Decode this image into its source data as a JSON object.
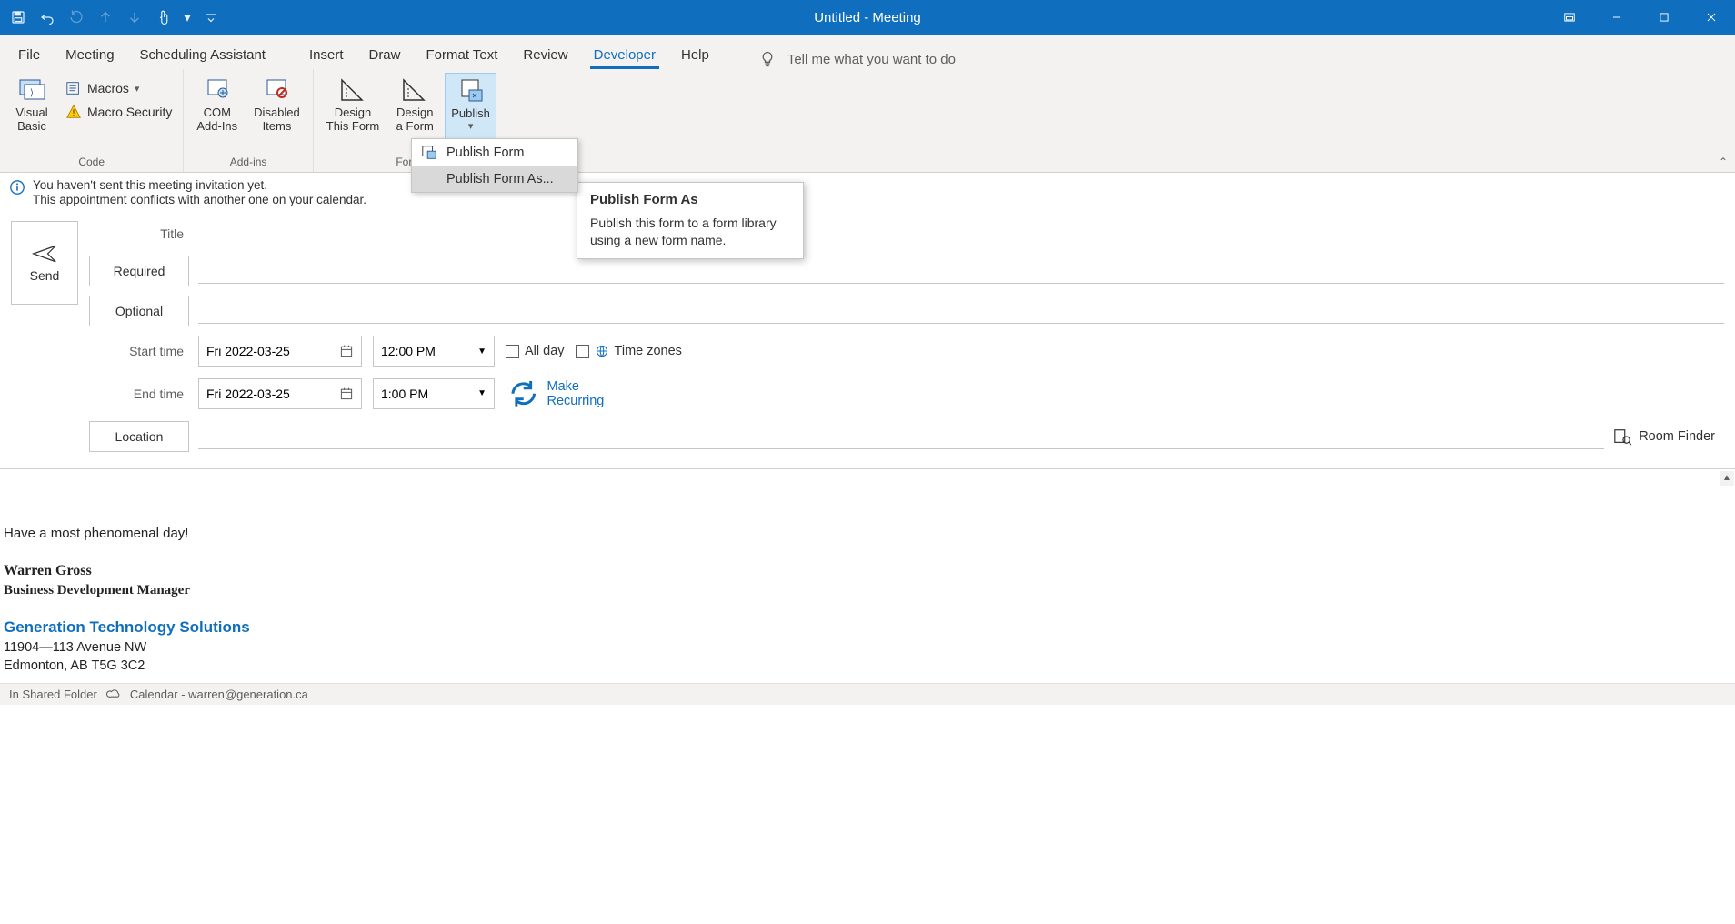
{
  "window": {
    "title": "Untitled  -  Meeting"
  },
  "qat": {
    "save": "Save",
    "undo": "Undo",
    "repeat": "Repeat",
    "send_up": "Send/Receive Up",
    "send_down": "Send/Receive Down",
    "touch": "Touch/Mouse Mode",
    "more": "Customize Quick Access"
  },
  "tabs": {
    "file": "File",
    "meeting": "Meeting",
    "scheduling": "Scheduling Assistant",
    "insert": "Insert",
    "draw": "Draw",
    "format": "Format Text",
    "review": "Review",
    "developer": "Developer",
    "help": "Help"
  },
  "tellme": {
    "placeholder": "Tell me what you want to do"
  },
  "ribbon": {
    "code": {
      "visual_basic_l1": "Visual",
      "visual_basic_l2": "Basic",
      "macros": "Macros",
      "macro_security": "Macro Security",
      "group_label": "Code"
    },
    "addins": {
      "com_l1": "COM",
      "com_l2": "Add-Ins",
      "disabled_l1": "Disabled",
      "disabled_l2": "Items",
      "group_label": "Add-ins"
    },
    "form": {
      "design_this_l1": "Design",
      "design_this_l2": "This Form",
      "design_a_l1": "Design",
      "design_a_l2": "a Form",
      "publish": "Publish",
      "group_label": "Form"
    }
  },
  "publish_menu": {
    "publish_form": "Publish Form",
    "publish_form_as": "Publish Form As..."
  },
  "tooltip": {
    "title": "Publish Form As",
    "body": "Publish this form to a form library using a new form name."
  },
  "info": {
    "line1": "You haven't sent this meeting invitation yet.",
    "line2": "This appointment conflicts with another one on your calendar."
  },
  "send": {
    "label": "Send"
  },
  "fields": {
    "title_label": "Title",
    "required": "Required",
    "optional": "Optional",
    "start_label": "Start time",
    "start_date": "Fri 2022-03-25",
    "start_time": "12:00 PM",
    "end_label": "End time",
    "end_date": "Fri 2022-03-25",
    "end_time": "1:00 PM",
    "all_day": "All day",
    "time_zones": "Time zones",
    "make_recurring": "Make Recurring",
    "location": "Location",
    "room_finder": "Room Finder"
  },
  "body": {
    "greeting": "Have a most phenomenal day!",
    "name": "Warren Gross",
    "role": "Business Development Manager",
    "company": "Generation Technology Solutions",
    "addr1": "11904—113 Avenue NW",
    "addr2": "Edmonton, AB T5G 3C2"
  },
  "status": {
    "folder": "In Shared Folder",
    "calendar": "Calendar - warren@generation.ca"
  }
}
